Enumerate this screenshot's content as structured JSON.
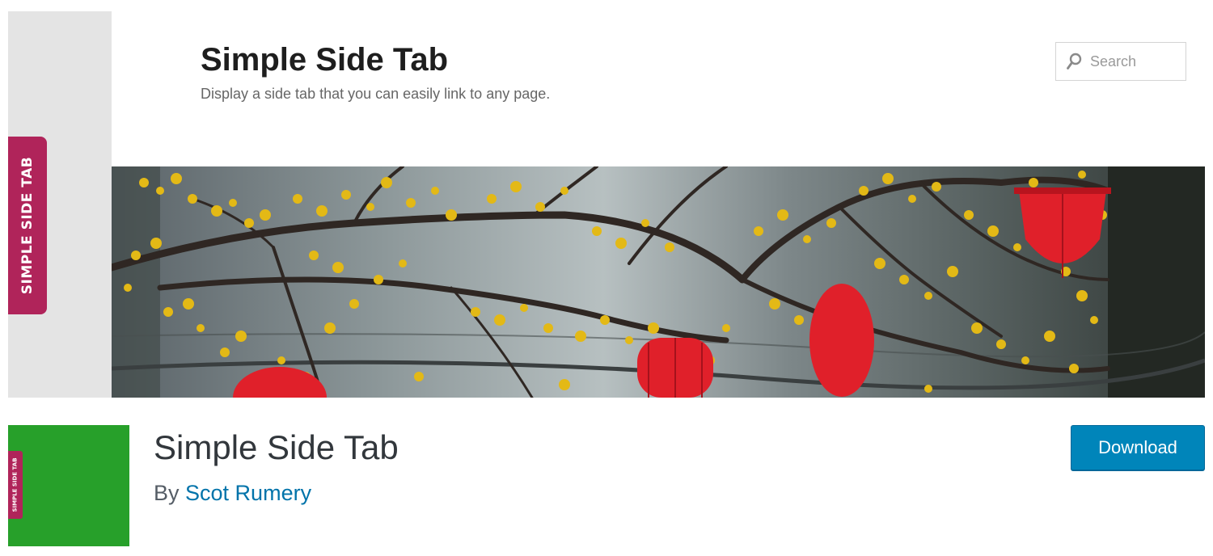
{
  "banner": {
    "side_tab_label": "SIMPLE SIDE TAB",
    "title": "Simple Side Tab",
    "tagline": "Display a side tab that you can easily link to any page.",
    "search_placeholder": "Search",
    "photo": "banner-photo-blossoms-lanterns"
  },
  "plugin": {
    "icon_tab_label": "SIMPLE SIDE TAB",
    "name": "Simple Side Tab",
    "author_prefix": "By",
    "author_name": "Scot Rumery",
    "download_label": "Download"
  },
  "colors": {
    "side_tab": "#b0245a",
    "icon_background": "#27a02a",
    "download_button": "#0085ba",
    "author_link": "#0073aa",
    "lantern": "#e0202a",
    "blossom": "#e3b916"
  },
  "icons": {
    "search": "search-icon"
  }
}
